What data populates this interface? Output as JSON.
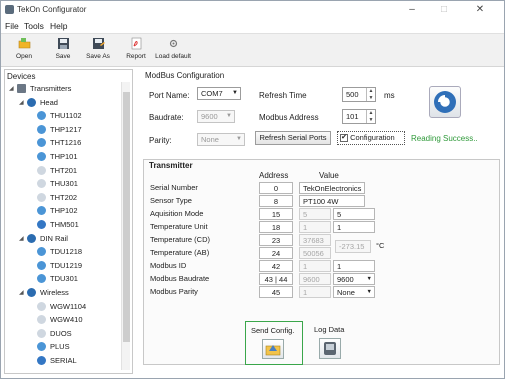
{
  "window": {
    "title": "TekOn Configurator",
    "controls": {
      "minimize": "–",
      "maximize": "□",
      "close": "✕"
    }
  },
  "menu": [
    "File",
    "Tools",
    "Help"
  ],
  "toolbar": [
    {
      "label": "Open",
      "icon": "folder-icon"
    },
    {
      "label": "Save",
      "icon": "save-icon"
    },
    {
      "label": "Save As",
      "icon": "save-as-icon"
    },
    {
      "label": "Report",
      "icon": "pdf-report-icon"
    },
    {
      "label": "Load default",
      "icon": "load-default-icon"
    }
  ],
  "devices": {
    "header": "Devices",
    "tree": [
      {
        "label": "Transmitters",
        "level": 0,
        "expanded": true
      },
      {
        "label": "Head",
        "level": 1,
        "expanded": true
      },
      {
        "label": "THU1102",
        "level": 2
      },
      {
        "label": "THP1217",
        "level": 2
      },
      {
        "label": "THT1216",
        "level": 2
      },
      {
        "label": "THP101",
        "level": 2
      },
      {
        "label": "THT201",
        "level": 2
      },
      {
        "label": "THU301",
        "level": 2
      },
      {
        "label": "THT202",
        "level": 2
      },
      {
        "label": "THP102",
        "level": 2
      },
      {
        "label": "THM501",
        "level": 2
      },
      {
        "label": "DIN Rail",
        "level": 1,
        "expanded": true
      },
      {
        "label": "TDU1218",
        "level": 2
      },
      {
        "label": "TDU1219",
        "level": 2
      },
      {
        "label": "TDU301",
        "level": 2
      },
      {
        "label": "Wireless",
        "level": 1,
        "expanded": true
      },
      {
        "label": "WGW1104",
        "level": 2
      },
      {
        "label": "WGW410",
        "level": 2
      },
      {
        "label": "DUOS",
        "level": 2
      },
      {
        "label": "PLUS",
        "level": 2
      },
      {
        "label": "SERIAL",
        "level": 2
      }
    ]
  },
  "modbus": {
    "group_label": "ModBus Configuration",
    "port_name_label": "Port Name:",
    "port_name_value": "COM7",
    "baudrate_label": "Baudrate:",
    "baudrate_value": "9600",
    "parity_label": "Parity:",
    "parity_value": "None",
    "refresh_time_label": "Refresh Time",
    "refresh_time_value": "500",
    "refresh_time_unit": "ms",
    "modbus_address_label": "Modbus Address",
    "modbus_address_value": "101",
    "refresh_button": "Refresh Serial Ports",
    "configuration_checkbox_label": "Configuration",
    "configuration_checked": true,
    "status": "Reading Success..",
    "status_color": "#2f9a3a"
  },
  "transmitter": {
    "group_label": "Transmitter",
    "col_address": "Address",
    "col_value": "Value",
    "rows": [
      {
        "name": "Serial Number",
        "address": "0",
        "value": "TekOnElectronics"
      },
      {
        "name": "Sensor Type",
        "address": "8",
        "value": "PT100 4W"
      },
      {
        "name": "Aquisition Mode",
        "address": "15",
        "value_read": "5",
        "value_write": "5"
      },
      {
        "name": "Temperature Unit",
        "address": "18",
        "value_read": "1",
        "value_write": "1"
      },
      {
        "name": "Temperature (CD)",
        "address": "23",
        "value_read": "37683",
        "value_calc": "-273.15",
        "unit": "°C"
      },
      {
        "name": "Temperature (AB)",
        "address": "24",
        "value_read": "50056"
      },
      {
        "name": "Modbus ID",
        "address": "42",
        "value_read": "1",
        "value_write": "1"
      },
      {
        "name": "Modbus Baudrate",
        "address": "43 | 44",
        "value_read": "9600",
        "value_write": "9600"
      },
      {
        "name": "Modbus Parity",
        "address": "45",
        "value_read": "1",
        "value_write": "None"
      }
    ],
    "send_config_label": "Send Config.",
    "log_data_label": "Log Data"
  }
}
